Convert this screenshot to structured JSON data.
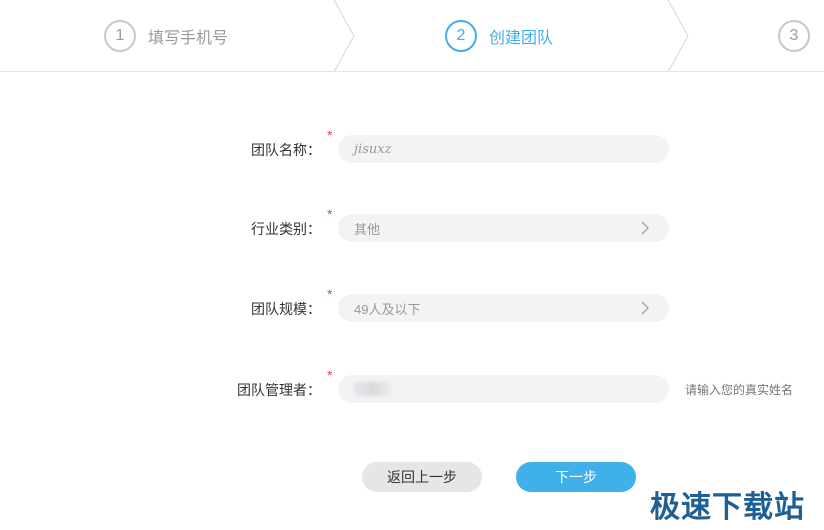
{
  "stepper": {
    "steps": [
      {
        "number": "1",
        "label": "填写手机号",
        "state": "done"
      },
      {
        "number": "2",
        "label": "创建团队",
        "state": "active"
      },
      {
        "number": "3",
        "label": "",
        "state": "pending"
      }
    ],
    "active_color": "#3fb0e9",
    "inactive_color": "#9a9a9a"
  },
  "form": {
    "team_name": {
      "label": "团队名称：",
      "required_mark": "*",
      "value": "jisuxz"
    },
    "industry": {
      "label": "行业类别：",
      "required_mark": "*",
      "value": "其他"
    },
    "team_size": {
      "label": "团队规模：",
      "required_mark": "*",
      "value": "49人及以下"
    },
    "manager": {
      "label": "团队管理者：",
      "required_mark": "*",
      "value": "",
      "hint": "请输入您的真实姓名"
    }
  },
  "buttons": {
    "back_label": "返回上一步",
    "next_label": "下一步"
  },
  "watermark": {
    "text": "极速下载站"
  },
  "colors": {
    "accent": "#3fb0e9",
    "required": "#e2493a",
    "field_bg": "#f1f3f5"
  }
}
